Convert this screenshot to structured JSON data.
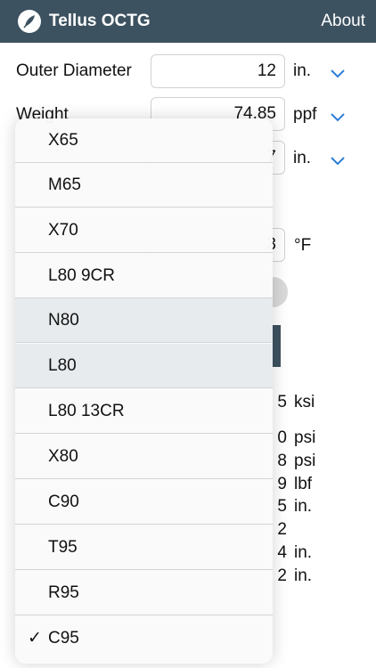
{
  "header": {
    "title": "Tellus OCTG",
    "about_label": "About",
    "logo_icon": "feather-leaf-icon",
    "bg_color": "#3d5260"
  },
  "form": {
    "outer_diameter": {
      "label": "Outer Diameter",
      "value": "12",
      "unit": "in."
    },
    "weight": {
      "label": "Weight",
      "value": "74.85",
      "unit": "ppf"
    },
    "field3": {
      "value": "7",
      "unit": "in."
    },
    "temperature": {
      "value": "3",
      "unit": "°F"
    }
  },
  "results": [
    {
      "value": "5",
      "unit": "ksi"
    },
    {
      "value": "0",
      "unit": "psi"
    },
    {
      "value": "8",
      "unit": "psi"
    },
    {
      "value": "9",
      "unit": "lbf"
    },
    {
      "value": "5",
      "unit": "in."
    },
    {
      "value": "2",
      "unit": ""
    },
    {
      "value": "4",
      "unit": "in."
    },
    {
      "value": "2",
      "unit": "in."
    }
  ],
  "dropdown": {
    "options": [
      {
        "label": "X65",
        "selected": false
      },
      {
        "label": "M65",
        "selected": false
      },
      {
        "label": "X70",
        "selected": false
      },
      {
        "label": "L80 9CR",
        "selected": false
      },
      {
        "label": "N80",
        "selected": false
      },
      {
        "label": "L80",
        "selected": false
      },
      {
        "label": "L80 13CR",
        "selected": false
      },
      {
        "label": "X80",
        "selected": false
      },
      {
        "label": "C90",
        "selected": false
      },
      {
        "label": "T95",
        "selected": false
      },
      {
        "label": "R95",
        "selected": false
      },
      {
        "label": "C95",
        "selected": true
      }
    ],
    "check_mark": "✓"
  },
  "colors": {
    "accent": "#2b7ed6"
  }
}
